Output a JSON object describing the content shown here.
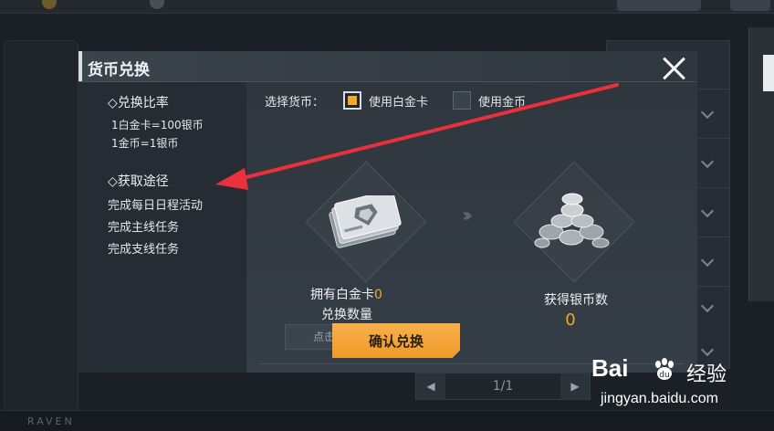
{
  "dialog": {
    "title": "货币兑换",
    "ratio_title": "◇兑换比率",
    "ratio_lines": [
      "1白金卡=100银币",
      "1金币=1银币"
    ],
    "ways_title": "◇获取途径",
    "ways": [
      "完成每日日程活动",
      "完成主线任务",
      "完成支线任务"
    ],
    "select_label": "选择货币：",
    "options": [
      {
        "label": "使用白金卡",
        "checked": true
      },
      {
        "label": "使用金币",
        "checked": false
      }
    ],
    "owned_label": "拥有白金卡",
    "owned_value": "0",
    "qty_label": "兑换数量",
    "qty_placeholder": "点击输入白金卡数量",
    "gain_label": "获得银币数",
    "gain_value": "0",
    "confirm_label": "确认兑换"
  },
  "background": {
    "pager": "1/1",
    "brand": "RAVEN"
  },
  "watermark": {
    "logo": "Bai",
    "logo_cn": "经验",
    "url": "jingyan.baidu.com"
  },
  "colors": {
    "accent": "#f3a826",
    "annotation": "#e8313a",
    "dialog_bg": "#2b323a"
  },
  "icons": [
    "close-icon",
    "platinum-card-icon",
    "silver-coins-icon",
    "double-chevron-right-icon",
    "chevron-down-icon"
  ]
}
